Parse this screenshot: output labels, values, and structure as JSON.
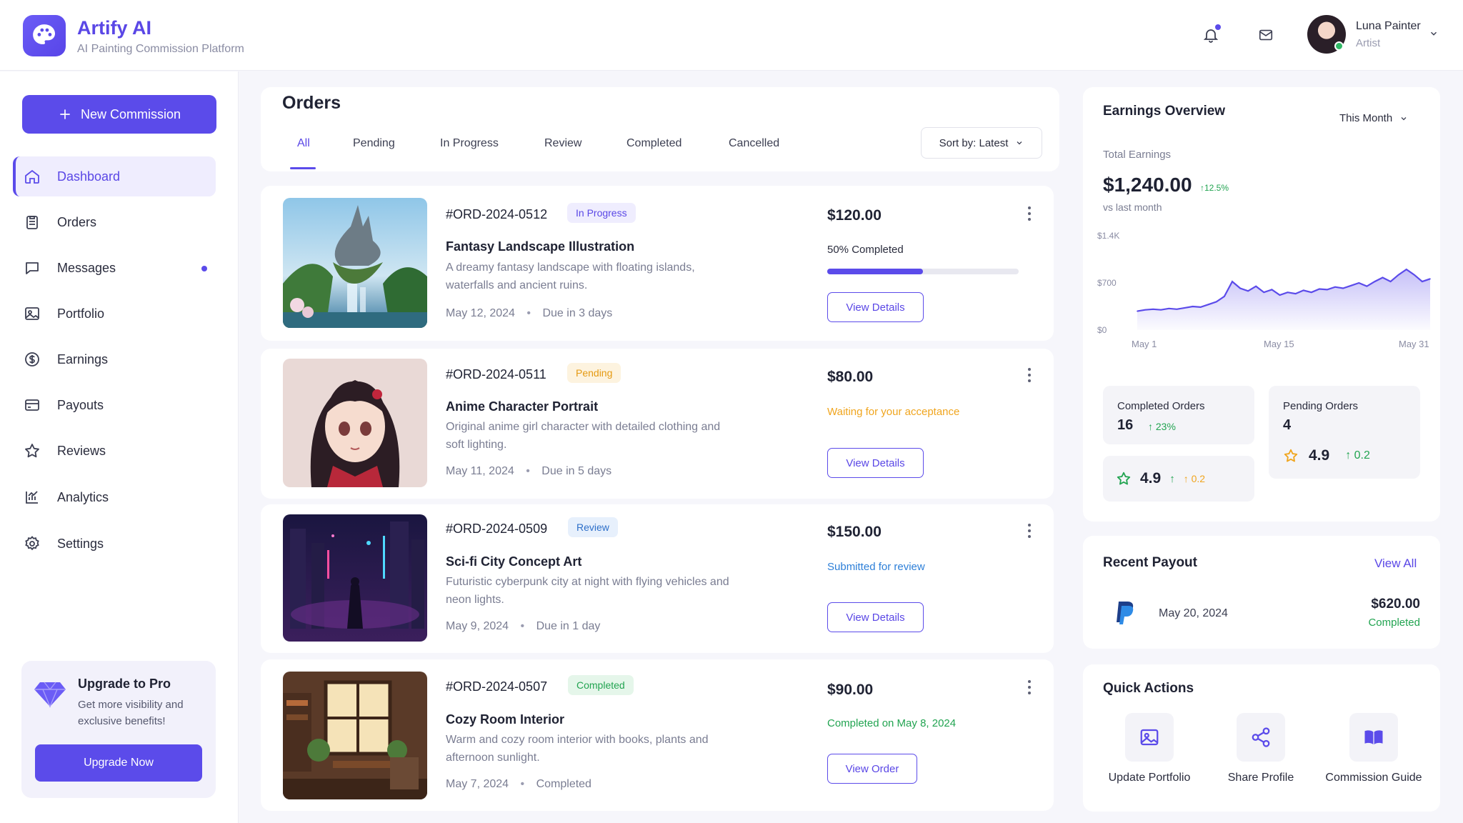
{
  "header": {
    "app_title": "Artify AI",
    "app_subtitle": "AI Painting Commission Platform",
    "user_name": "Luna Painter",
    "user_role": "Artist"
  },
  "sidebar": {
    "new_commission": "New Commission",
    "items": [
      {
        "label": "Dashboard",
        "icon": "home-icon"
      },
      {
        "label": "Orders",
        "icon": "clipboard-icon"
      },
      {
        "label": "Messages",
        "icon": "chat-icon"
      },
      {
        "label": "Portfolio",
        "icon": "image-icon"
      },
      {
        "label": "Earnings",
        "icon": "dollar-icon"
      },
      {
        "label": "Payouts",
        "icon": "card-icon"
      },
      {
        "label": "Reviews",
        "icon": "star-icon"
      },
      {
        "label": "Analytics",
        "icon": "chart-icon"
      },
      {
        "label": "Settings",
        "icon": "gear-icon"
      }
    ],
    "upgrade": {
      "title": "Upgrade to Pro",
      "desc": "Get more visibility and exclusive benefits!",
      "button": "Upgrade Now"
    }
  },
  "orders": {
    "title": "Orders",
    "tabs": [
      "All",
      "Pending",
      "In Progress",
      "Review",
      "Completed",
      "Cancelled"
    ],
    "sort_label": "Sort by: Latest",
    "list": [
      {
        "id": "#ORD-2024-0512",
        "badge": "In Progress",
        "title": "Fantasy Landscape Illustration",
        "desc": "A dreamy fantasy landscape with floating islands, waterfalls and ancient ruins.",
        "date": "May 12, 2024",
        "due": "Due in 3 days",
        "price": "$120.00",
        "status": "50% Completed",
        "progress": 0.5,
        "button": "View Details"
      },
      {
        "id": "#ORD-2024-0511",
        "badge": "Pending",
        "title": "Anime Character Portrait",
        "desc": "Original anime girl character with detailed clothing and soft lighting.",
        "date": "May 11, 2024",
        "due": "Due in 5 days",
        "price": "$80.00",
        "status": "Waiting for your acceptance",
        "button": "View Details"
      },
      {
        "id": "#ORD-2024-0509",
        "badge": "Review",
        "title": "Sci-fi City Concept Art",
        "desc": "Futuristic cyberpunk city at night with flying vehicles and neon lights.",
        "date": "May 9, 2024",
        "due": "Due in 1 day",
        "price": "$150.00",
        "status": "Submitted for review",
        "button": "View Details"
      },
      {
        "id": "#ORD-2024-0507",
        "badge": "Completed",
        "title": "Cozy Room Interior",
        "desc": "Warm and cozy room interior with books, plants and afternoon sunlight.",
        "date": "May 7, 2024",
        "due": "Completed",
        "price": "$90.00",
        "status": "Completed on May 8, 2024",
        "button": "View Order"
      }
    ]
  },
  "earnings": {
    "title": "Earnings Overview",
    "period": "This Month",
    "total_label": "Total Earnings",
    "total": "$1,240.00",
    "change": "12.5%",
    "vs": "vs last month",
    "completed_label": "Completed Orders",
    "completed_value": "16",
    "completed_change": "23%",
    "pending_label": "Pending Orders",
    "pending_value": "4",
    "rating_a": "4.9",
    "rating_a_change": "0.2",
    "rating_b": "4.9",
    "rating_b_change": "0.2"
  },
  "chart_data": {
    "type": "area",
    "x_ticks": [
      "May 1",
      "May 15",
      "May 31"
    ],
    "y_ticks": [
      "$1.4K",
      "$700",
      "$0"
    ],
    "ylim": [
      0,
      1400
    ],
    "values": [
      280,
      300,
      310,
      300,
      320,
      310,
      330,
      350,
      340,
      380,
      420,
      500,
      720,
      620,
      580,
      650,
      560,
      600,
      520,
      560,
      540,
      590,
      560,
      610,
      600,
      640,
      620,
      660,
      700,
      650,
      720,
      780,
      720,
      820,
      900,
      820,
      720,
      760
    ]
  },
  "payout": {
    "title": "Recent Payout",
    "view_all": "View All",
    "date": "May 20, 2024",
    "amount": "$620.00",
    "status": "Completed"
  },
  "quick_actions": {
    "title": "Quick Actions",
    "items": [
      "Update Portfolio",
      "Share Profile",
      "Commission Guide"
    ]
  },
  "colors": {
    "accent": "#5b4bea",
    "pending": "#f0a51e",
    "review": "#2d7fd8",
    "completed": "#22a451"
  }
}
